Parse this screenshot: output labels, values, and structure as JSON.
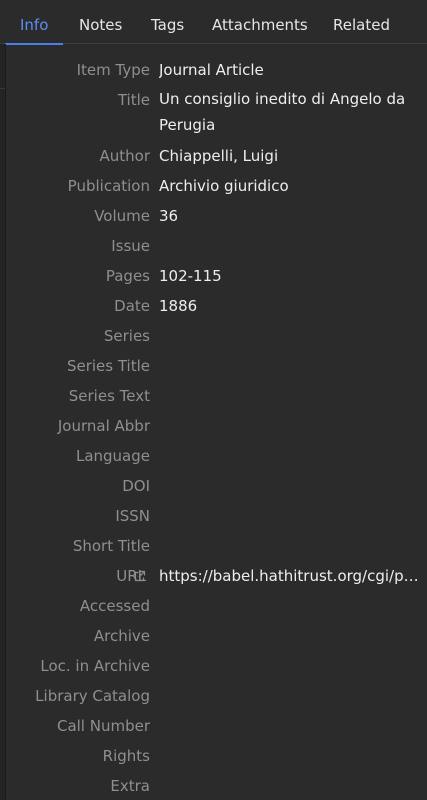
{
  "tabs": [
    {
      "label": "Info",
      "active": true
    },
    {
      "label": "Notes",
      "active": false
    },
    {
      "label": "Tags",
      "active": false
    },
    {
      "label": "Attachments",
      "active": false
    },
    {
      "label": "Related",
      "active": false
    }
  ],
  "fields": {
    "item_type": {
      "label": "Item Type",
      "value": "Journal Article"
    },
    "title": {
      "label": "Title",
      "value": "Un consiglio inedito di Angelo da Perugia"
    },
    "author": {
      "label": "Author",
      "value": "Chiappelli, Luigi"
    },
    "publication": {
      "label": "Publication",
      "value": "Archivio giuridico"
    },
    "volume": {
      "label": "Volume",
      "value": "36"
    },
    "issue": {
      "label": "Issue",
      "value": ""
    },
    "pages": {
      "label": "Pages",
      "value": "102-115"
    },
    "date": {
      "label": "Date",
      "value": "1886"
    },
    "series": {
      "label": "Series",
      "value": ""
    },
    "series_title": {
      "label": "Series Title",
      "value": ""
    },
    "series_text": {
      "label": "Series Text",
      "value": ""
    },
    "journal_abbr": {
      "label": "Journal Abbr",
      "value": ""
    },
    "language": {
      "label": "Language",
      "value": ""
    },
    "doi": {
      "label": "DOI",
      "value": ""
    },
    "issn": {
      "label": "ISSN",
      "value": ""
    },
    "short_title": {
      "label": "Short Title",
      "value": ""
    },
    "url": {
      "label": "URL",
      "value": "https://babel.hathitrust.org/cgi/pt..."
    },
    "accessed": {
      "label": "Accessed",
      "value": ""
    },
    "archive": {
      "label": "Archive",
      "value": ""
    },
    "loc_in_archive": {
      "label": "Loc. in Archive",
      "value": ""
    },
    "library_catalog": {
      "label": "Library Catalog",
      "value": ""
    },
    "call_number": {
      "label": "Call Number",
      "value": ""
    },
    "rights": {
      "label": "Rights",
      "value": ""
    },
    "extra": {
      "label": "Extra",
      "value": ""
    }
  },
  "icons": {
    "url_open": "external-link-icon"
  },
  "colors": {
    "accent": "#5b8df5",
    "background": "#2b2b2b",
    "label": "#8f8f8f",
    "value": "#eeeeee"
  }
}
